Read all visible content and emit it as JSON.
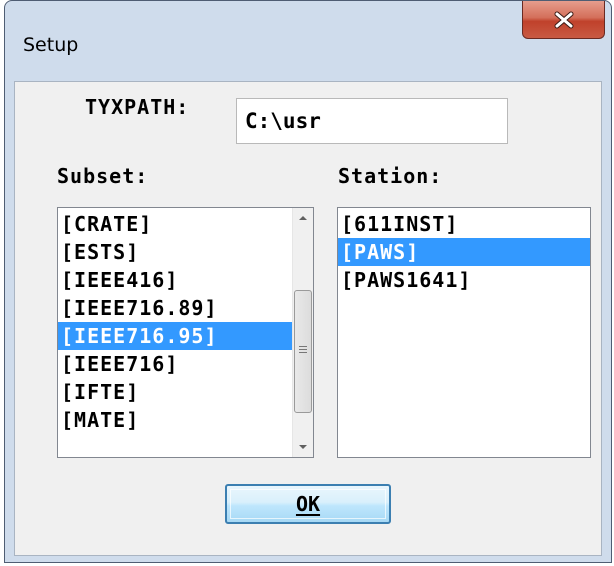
{
  "window": {
    "title": "Setup",
    "close_icon": "close-x-icon",
    "accent_close": "#c7503a"
  },
  "tyxpath": {
    "label": "TYXPATH:",
    "value": "C:\\usr"
  },
  "subset": {
    "label": "Subset:",
    "items": [
      {
        "label": "[CRATE]"
      },
      {
        "label": "[ESTS]"
      },
      {
        "label": "[IEEE416]"
      },
      {
        "label": "[IEEE716.89]"
      },
      {
        "label": "[IEEE716.95]"
      },
      {
        "label": "[IEEE716]"
      },
      {
        "label": "[IFTE]"
      },
      {
        "label": "[MATE]"
      }
    ],
    "selected_index": 4,
    "scrollbar": {
      "up_icon": "scroll-up-arrow-icon",
      "down_icon": "scroll-down-arrow-icon"
    }
  },
  "station": {
    "label": "Station:",
    "items": [
      {
        "label": "[611INST]"
      },
      {
        "label": "[PAWS]"
      },
      {
        "label": "[PAWS1641]"
      }
    ],
    "selected_index": 1
  },
  "buttons": {
    "ok_label": "OK"
  },
  "colors": {
    "selection": "#3399ff",
    "window_frame": "#cfdcec"
  }
}
